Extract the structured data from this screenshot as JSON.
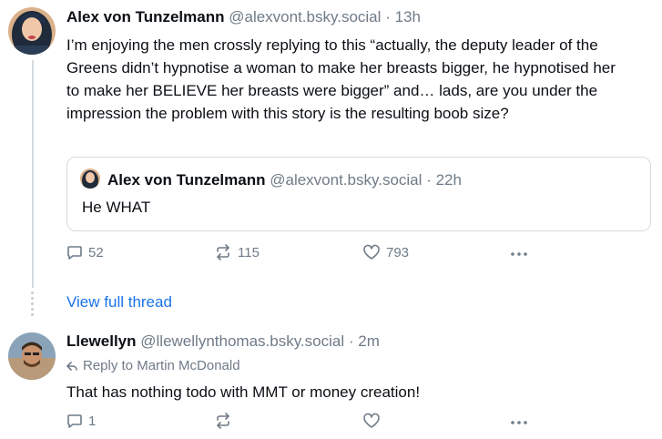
{
  "post1": {
    "author_name": "Alex von Tunzelmann",
    "author_handle": "@alexvont.bsky.social",
    "separator": "·",
    "time": "13h",
    "text": "I’m enjoying the men crossly replying to this “actually, the deputy leader of the Greens didn’t hypnotise a woman to make her breasts bigger, he hypnotised her to make her BELIEVE her breasts were bigger” and… lads, are you under the impression the problem with this story is the resulting boob size?",
    "quote": {
      "author_name": "Alex von Tunzelmann",
      "author_handle": "@alexvont.bsky.social",
      "separator": "·",
      "time": "22h",
      "text": "He WHAT"
    },
    "replies_count": "52",
    "reposts_count": "115",
    "likes_count": "793"
  },
  "view_full_thread": "View full thread",
  "post2": {
    "author_name": "Llewellyn",
    "author_handle": "@llewellynthomas.bsky.social",
    "separator": "·",
    "time": "2m",
    "reply_to": "Reply to Martin McDonald",
    "text": "That has nothing todo with MMT or money creation!",
    "replies_count": "1"
  },
  "icons": {
    "reply": "speech-bubble-icon",
    "repost": "repost-arrows-icon",
    "like": "heart-icon",
    "more": "ellipsis-icon",
    "reply_arrow": "reply-arrow-icon"
  },
  "colors": {
    "muted": "#6f7b88",
    "link": "#1a73e8",
    "border": "#d4dbe2"
  }
}
